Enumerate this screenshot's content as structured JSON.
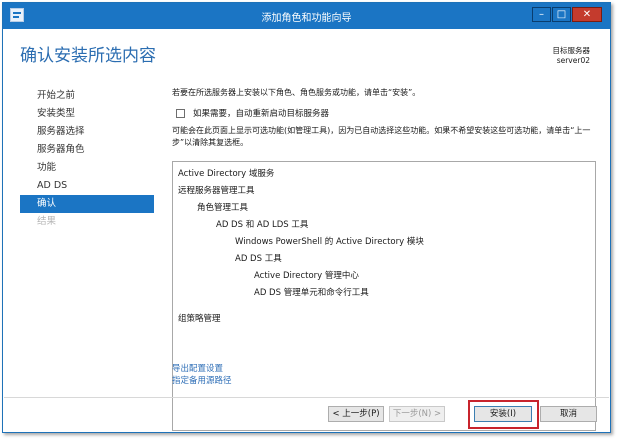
{
  "window": {
    "title": "添加角色和功能向导"
  },
  "header": {
    "page_title": "确认安装所选内容",
    "target_label": "目标服务器",
    "target_value": "server02"
  },
  "nav": {
    "items": [
      {
        "label": "开始之前"
      },
      {
        "label": "安装类型"
      },
      {
        "label": "服务器选择"
      },
      {
        "label": "服务器角色"
      },
      {
        "label": "功能"
      },
      {
        "label": "AD DS"
      },
      {
        "label": "确认"
      },
      {
        "label": "结果"
      }
    ]
  },
  "content": {
    "intro": "若要在所选服务器上安装以下角色、角色服务或功能，请单击“安装”。",
    "restart_label": "如果需要，自动重新启动目标服务器",
    "restart_checked": false,
    "note": "可能会在此页面上显示可选功能(如管理工具)，因为已自动选择这些功能。如果不希望安装这些可选功能，请单击“上一步”以清除其复选框。",
    "features": [
      {
        "label": "Active Directory 域服务",
        "level": 0
      },
      {
        "label": "远程服务器管理工具",
        "level": 0
      },
      {
        "label": "角色管理工具",
        "level": 1
      },
      {
        "label": "AD DS 和 AD LDS 工具",
        "level": 2
      },
      {
        "label": "Windows PowerShell 的 Active Directory 模块",
        "level": 3
      },
      {
        "label": "AD DS 工具",
        "level": 3
      },
      {
        "label": "Active Directory 管理中心",
        "level": 4
      },
      {
        "label": "AD DS 管理单元和命令行工具",
        "level": 4
      },
      {
        "label": "组策略管理",
        "level": 0
      }
    ],
    "links": {
      "export": "导出配置设置",
      "alternate_source": "指定备用源路径"
    }
  },
  "footer": {
    "prev": "< 上一步(P)",
    "next": "下一步(N) >",
    "install": "安装(I)",
    "cancel": "取消"
  }
}
